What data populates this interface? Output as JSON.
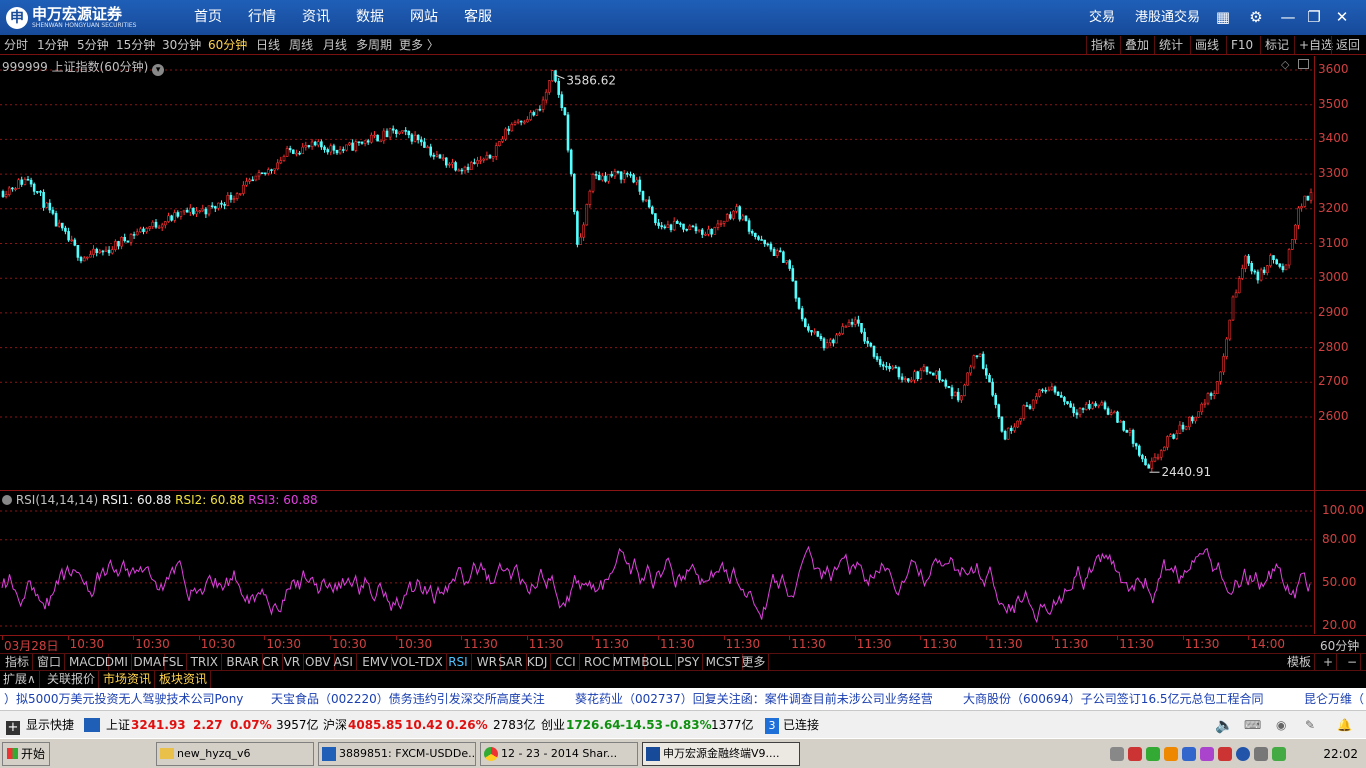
{
  "app": {
    "brand": "申万宏源证券",
    "brand_sub": "SHENWAN HONGYUAN SECURITIES"
  },
  "nav": [
    "首页",
    "行情",
    "资讯",
    "数据",
    "网站",
    "客服"
  ],
  "top_right": [
    "交易",
    "港股通交易"
  ],
  "periods": [
    "分时",
    "1分钟",
    "5分钟",
    "15分钟",
    "30分钟",
    "60分钟",
    "日线",
    "周线",
    "月线",
    "多周期",
    "更多 〉"
  ],
  "active_period": "60分钟",
  "tools": [
    "指标",
    "叠加",
    "统计",
    "画线",
    "F10",
    "标记",
    "+自选",
    "返回"
  ],
  "chart_title": "999999 上证指数(60分钟)",
  "rsi": {
    "label": "RSI(14,14,14)",
    "rsi1": "RSI1: 60.88",
    "rsi2": "RSI2: 60.88",
    "rsi3": "RSI3: 60.88"
  },
  "colors": {
    "up": "#ff3030",
    "down": "#54ffff",
    "rsi": "#e040e0",
    "grid": "#8b1515",
    "axis_text": "#d04040"
  },
  "price_labels": [
    "3600",
    "3500",
    "3400",
    "3300",
    "3200",
    "3100",
    "3000",
    "2900",
    "2800",
    "2700",
    "2600"
  ],
  "rsi_labels": [
    "100.00",
    "80.00",
    "50.00",
    "20.00"
  ],
  "time_labels": [
    "03月28日",
    "10:30",
    "10:30",
    "10:30",
    "10:30",
    "10:30",
    "10:30",
    "11:30",
    "11:30",
    "11:30",
    "11:30",
    "11:30",
    "11:30",
    "11:30",
    "11:30",
    "11:30",
    "11:30",
    "11:30",
    "11:30",
    "14:00"
  ],
  "period_axis_label": "60分钟",
  "indicators": [
    "指标",
    "窗口",
    "MACD",
    "DMI",
    "DMA",
    "FSL",
    "TRIX",
    "BRAR",
    "CR",
    "VR",
    "OBV",
    "ASI",
    "EMV",
    "VOL-TDX",
    "RSI",
    "WR",
    "SAR",
    "KDJ",
    "CCI",
    "ROC",
    "MTM",
    "BOLL",
    "PSY",
    "MCST",
    "更多"
  ],
  "active_indicator": "RSI",
  "indicator_right": [
    "模板",
    "+",
    "−"
  ],
  "subtabs": [
    "扩展∧",
    "关联报价",
    "市场资讯",
    "板块资讯"
  ],
  "news": [
    "）拟5000万美元投资无人驾驶技术公司Pony",
    "天宝食品（002220）债务违约引发深交所高度关注",
    "葵花药业（002737）回复关注函：案件调查目前未涉公司业务经营",
    "大商股份（600694）子公司签订16.5亿元总包工程合同",
    "昆仑万维（"
  ],
  "status": {
    "shortcut": "显示快捷",
    "sh_name": "上证",
    "sh_value": "3241.93",
    "sh_change": "2.27",
    "sh_pct": "0.07%",
    "sh_amount": "3957亿",
    "sz_name": "沪深",
    "sz_value": "4085.85",
    "sz_change": "10.42",
    "sz_pct": "0.26%",
    "sz_amount": "2783亿",
    "cy_name": "创业",
    "cy_value": "1726.64",
    "cy_change": "-14.53",
    "cy_pct": "-0.83%",
    "cy_amount": "1377亿",
    "conn_num": "3",
    "conn_text": "已连接"
  },
  "taskbar": {
    "start": "开始",
    "tasks": [
      "new_hyzq_v6",
      "3889851: FXCM-USDDe...",
      "12 - 23 - 2014 Shar...",
      "申万宏源金融终端V9...."
    ],
    "clock": "22:02"
  },
  "chart_data": {
    "type": "candlestick",
    "title": "999999 上证指数(60分钟)",
    "yrange": [
      2400,
      3620
    ],
    "annotations": [
      {
        "label": "3586.62",
        "value": 3586.62
      },
      {
        "label": "2440.91",
        "value": 2440.91
      }
    ],
    "anchors": [
      [
        0,
        3250
      ],
      [
        0.02,
        3290
      ],
      [
        0.04,
        3160
      ],
      [
        0.06,
        3060
      ],
      [
        0.08,
        3080
      ],
      [
        0.1,
        3130
      ],
      [
        0.12,
        3160
      ],
      [
        0.14,
        3190
      ],
      [
        0.16,
        3200
      ],
      [
        0.18,
        3250
      ],
      [
        0.2,
        3300
      ],
      [
        0.22,
        3370
      ],
      [
        0.24,
        3380
      ],
      [
        0.26,
        3370
      ],
      [
        0.28,
        3400
      ],
      [
        0.3,
        3420
      ],
      [
        0.32,
        3400
      ],
      [
        0.33,
        3350
      ],
      [
        0.35,
        3320
      ],
      [
        0.37,
        3340
      ],
      [
        0.39,
        3450
      ],
      [
        0.41,
        3480
      ],
      [
        0.42,
        3586.62
      ],
      [
        0.43,
        3460
      ],
      [
        0.44,
        3070
      ],
      [
        0.45,
        3290
      ],
      [
        0.48,
        3300
      ],
      [
        0.49,
        3230
      ],
      [
        0.5,
        3150
      ],
      [
        0.52,
        3150
      ],
      [
        0.54,
        3130
      ],
      [
        0.56,
        3200
      ],
      [
        0.58,
        3100
      ],
      [
        0.6,
        3050
      ],
      [
        0.61,
        2880
      ],
      [
        0.63,
        2800
      ],
      [
        0.65,
        2880
      ],
      [
        0.67,
        2760
      ],
      [
        0.69,
        2710
      ],
      [
        0.71,
        2740
      ],
      [
        0.73,
        2650
      ],
      [
        0.745,
        2790
      ],
      [
        0.755,
        2700
      ],
      [
        0.765,
        2540
      ],
      [
        0.78,
        2620
      ],
      [
        0.8,
        2690
      ],
      [
        0.82,
        2620
      ],
      [
        0.84,
        2640
      ],
      [
        0.86,
        2560
      ],
      [
        0.875,
        2440.91
      ],
      [
        0.89,
        2530
      ],
      [
        0.91,
        2600
      ],
      [
        0.93,
        2700
      ],
      [
        0.94,
        2930
      ],
      [
        0.95,
        3060
      ],
      [
        0.96,
        3000
      ],
      [
        0.97,
        3060
      ],
      [
        0.98,
        3010
      ],
      [
        0.99,
        3200
      ],
      [
        1,
        3241.93
      ]
    ]
  }
}
